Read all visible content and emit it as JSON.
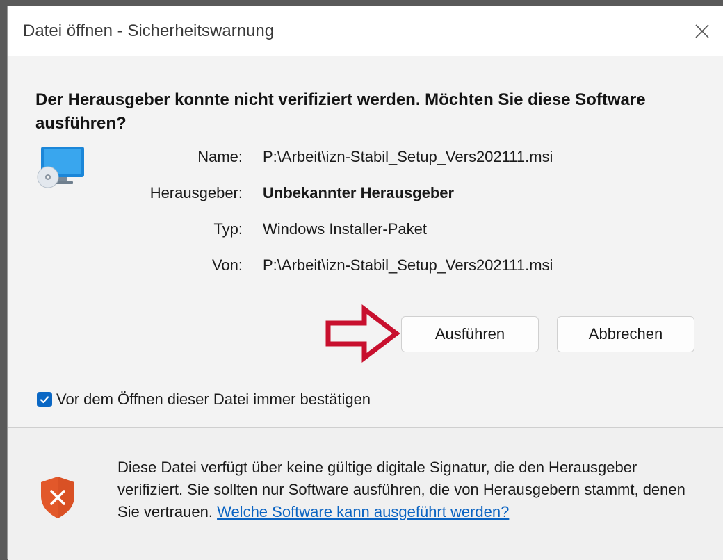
{
  "window": {
    "title": "Datei öffnen - Sicherheitswarnung"
  },
  "question": "Der Herausgeber konnte nicht verifiziert werden. Möchten Sie diese Software ausführen?",
  "info": {
    "rows": [
      {
        "label": "Name:",
        "value": "P:\\Arbeit\\izn-Stabil_Setup_Vers202111.msi"
      },
      {
        "label": "Herausgeber:",
        "value": "Unbekannter Herausgeber"
      },
      {
        "label": "Typ:",
        "value": "Windows Installer-Paket"
      },
      {
        "label": "Von:",
        "value": "P:\\Arbeit\\izn-Stabil_Setup_Vers202111.msi"
      }
    ]
  },
  "buttons": {
    "run_label": "Ausführen",
    "cancel_label": "Abbrechen"
  },
  "checkbox": {
    "label": "Vor dem Öffnen dieser Datei immer bestätigen",
    "checked": true
  },
  "footer": {
    "text": "Diese Datei verfügt über keine gültige digitale Signatur, die den Herausgeber verifiziert. Sie sollten nur Software ausführen, die von Herausgebern stammt, denen Sie vertrauen. ",
    "link_text": "Welche Software kann ausgeführt werden?"
  },
  "icons": {
    "app": "installer-monitor-icon",
    "shield": "shield-x-icon",
    "arrow": "red-arrow-annotation",
    "close": "close-icon",
    "check": "checkmark-icon"
  },
  "colors": {
    "accent": "#0a67c4",
    "link": "#0a63c2",
    "shield": "#e2582a",
    "arrow": "#c8102e"
  }
}
